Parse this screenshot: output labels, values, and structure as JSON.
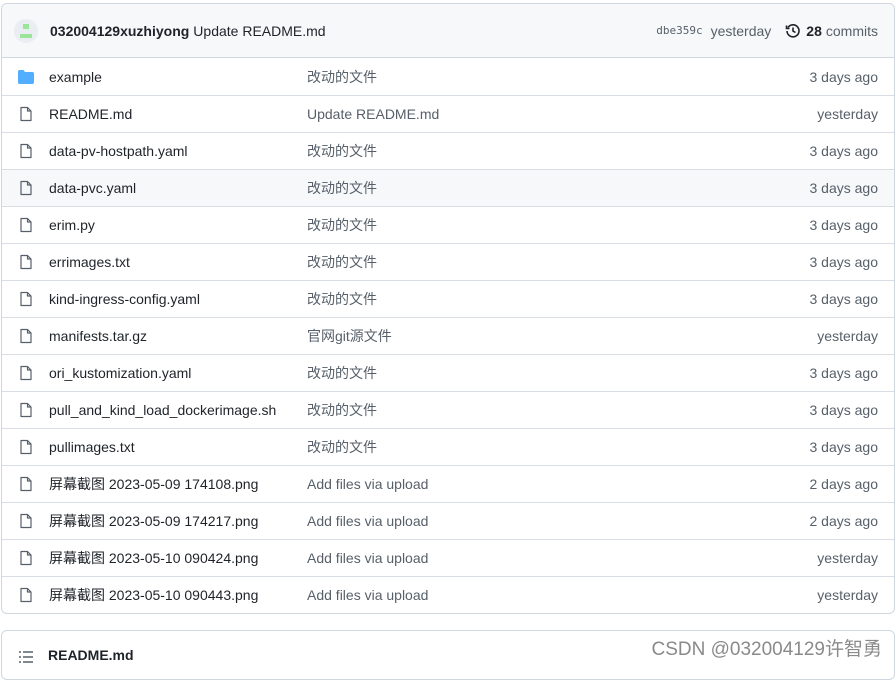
{
  "commit": {
    "author": "032004129xuzhiyong",
    "message": "Update README.md",
    "sha": "dbe359c",
    "time": "yesterday",
    "count": "28",
    "count_label": "commits"
  },
  "files": [
    {
      "name": "example",
      "type": "folder",
      "message": "改动的文件",
      "age": "3 days ago"
    },
    {
      "name": "README.md",
      "type": "file",
      "message": "Update README.md",
      "age": "yesterday"
    },
    {
      "name": "data-pv-hostpath.yaml",
      "type": "file",
      "message": "改动的文件",
      "age": "3 days ago"
    },
    {
      "name": "data-pvc.yaml",
      "type": "file",
      "message": "改动的文件",
      "age": "3 days ago"
    },
    {
      "name": "erim.py",
      "type": "file",
      "message": "改动的文件",
      "age": "3 days ago"
    },
    {
      "name": "errimages.txt",
      "type": "file",
      "message": "改动的文件",
      "age": "3 days ago"
    },
    {
      "name": "kind-ingress-config.yaml",
      "type": "file",
      "message": "改动的文件",
      "age": "3 days ago"
    },
    {
      "name": "manifests.tar.gz",
      "type": "file",
      "message": "官网git源文件",
      "age": "yesterday"
    },
    {
      "name": "ori_kustomization.yaml",
      "type": "file",
      "message": "改动的文件",
      "age": "3 days ago"
    },
    {
      "name": "pull_and_kind_load_dockerimage.sh",
      "type": "file",
      "message": "改动的文件",
      "age": "3 days ago"
    },
    {
      "name": "pullimages.txt",
      "type": "file",
      "message": "改动的文件",
      "age": "3 days ago"
    },
    {
      "name": "屏幕截图 2023-05-09 174108.png",
      "type": "file",
      "message": "Add files via upload",
      "age": "2 days ago"
    },
    {
      "name": "屏幕截图 2023-05-09 174217.png",
      "type": "file",
      "message": "Add files via upload",
      "age": "2 days ago"
    },
    {
      "name": "屏幕截图 2023-05-10 090424.png",
      "type": "file",
      "message": "Add files via upload",
      "age": "yesterday"
    },
    {
      "name": "屏幕截图 2023-05-10 090443.png",
      "type": "file",
      "message": "Add files via upload",
      "age": "yesterday"
    }
  ],
  "readme": {
    "label": "README.md"
  },
  "watermark": "CSDN @032004129许智勇",
  "colors": {
    "folder": "#54aeff",
    "muted": "#57606a",
    "border": "#d0d7de"
  }
}
